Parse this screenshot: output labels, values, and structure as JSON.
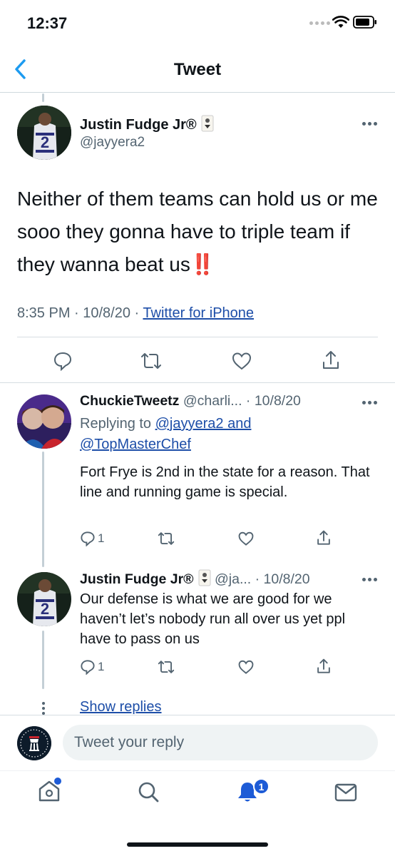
{
  "status_bar": {
    "time": "12:37"
  },
  "nav": {
    "title": "Tweet"
  },
  "main_tweet": {
    "name": "Justin Fudge Jr®",
    "handle": "@jayyera2",
    "avatar_number": "2",
    "text": "Neither of them teams can hold us or me sooo they gonna have to triple team if they wanna beat us‼️",
    "meta_time": "8:35 PM · 10/8/20 · ",
    "source": "Twitter for iPhone"
  },
  "replies": [
    {
      "name": "ChuckieTweetz",
      "handle_date": " @charli... · 10/8/20",
      "replying_prefix": "Replying to ",
      "replying_line1": "@jayyera2 and",
      "replying_line2": "@TopMasterChef",
      "text": "Fort Frye is 2nd in the state for a reason. That line and running game is special.",
      "reply_count": "1"
    },
    {
      "name": "Justin Fudge Jr®",
      "handle_date": " @ja... · 10/8/20",
      "text": "Our defense is what we are good for we haven’t let’s nobody run all over us yet ppl have to pass on us",
      "reply_count": "1",
      "avatar_number": "2"
    }
  ],
  "show_replies": "Show replies",
  "compose": {
    "placeholder": "Tweet your reply"
  },
  "tab_bar": {
    "notification_count": "1"
  },
  "colors": {
    "link": "#1d4ea8",
    "accent": "#1d9bf0",
    "badge": "#1d5bd6"
  }
}
